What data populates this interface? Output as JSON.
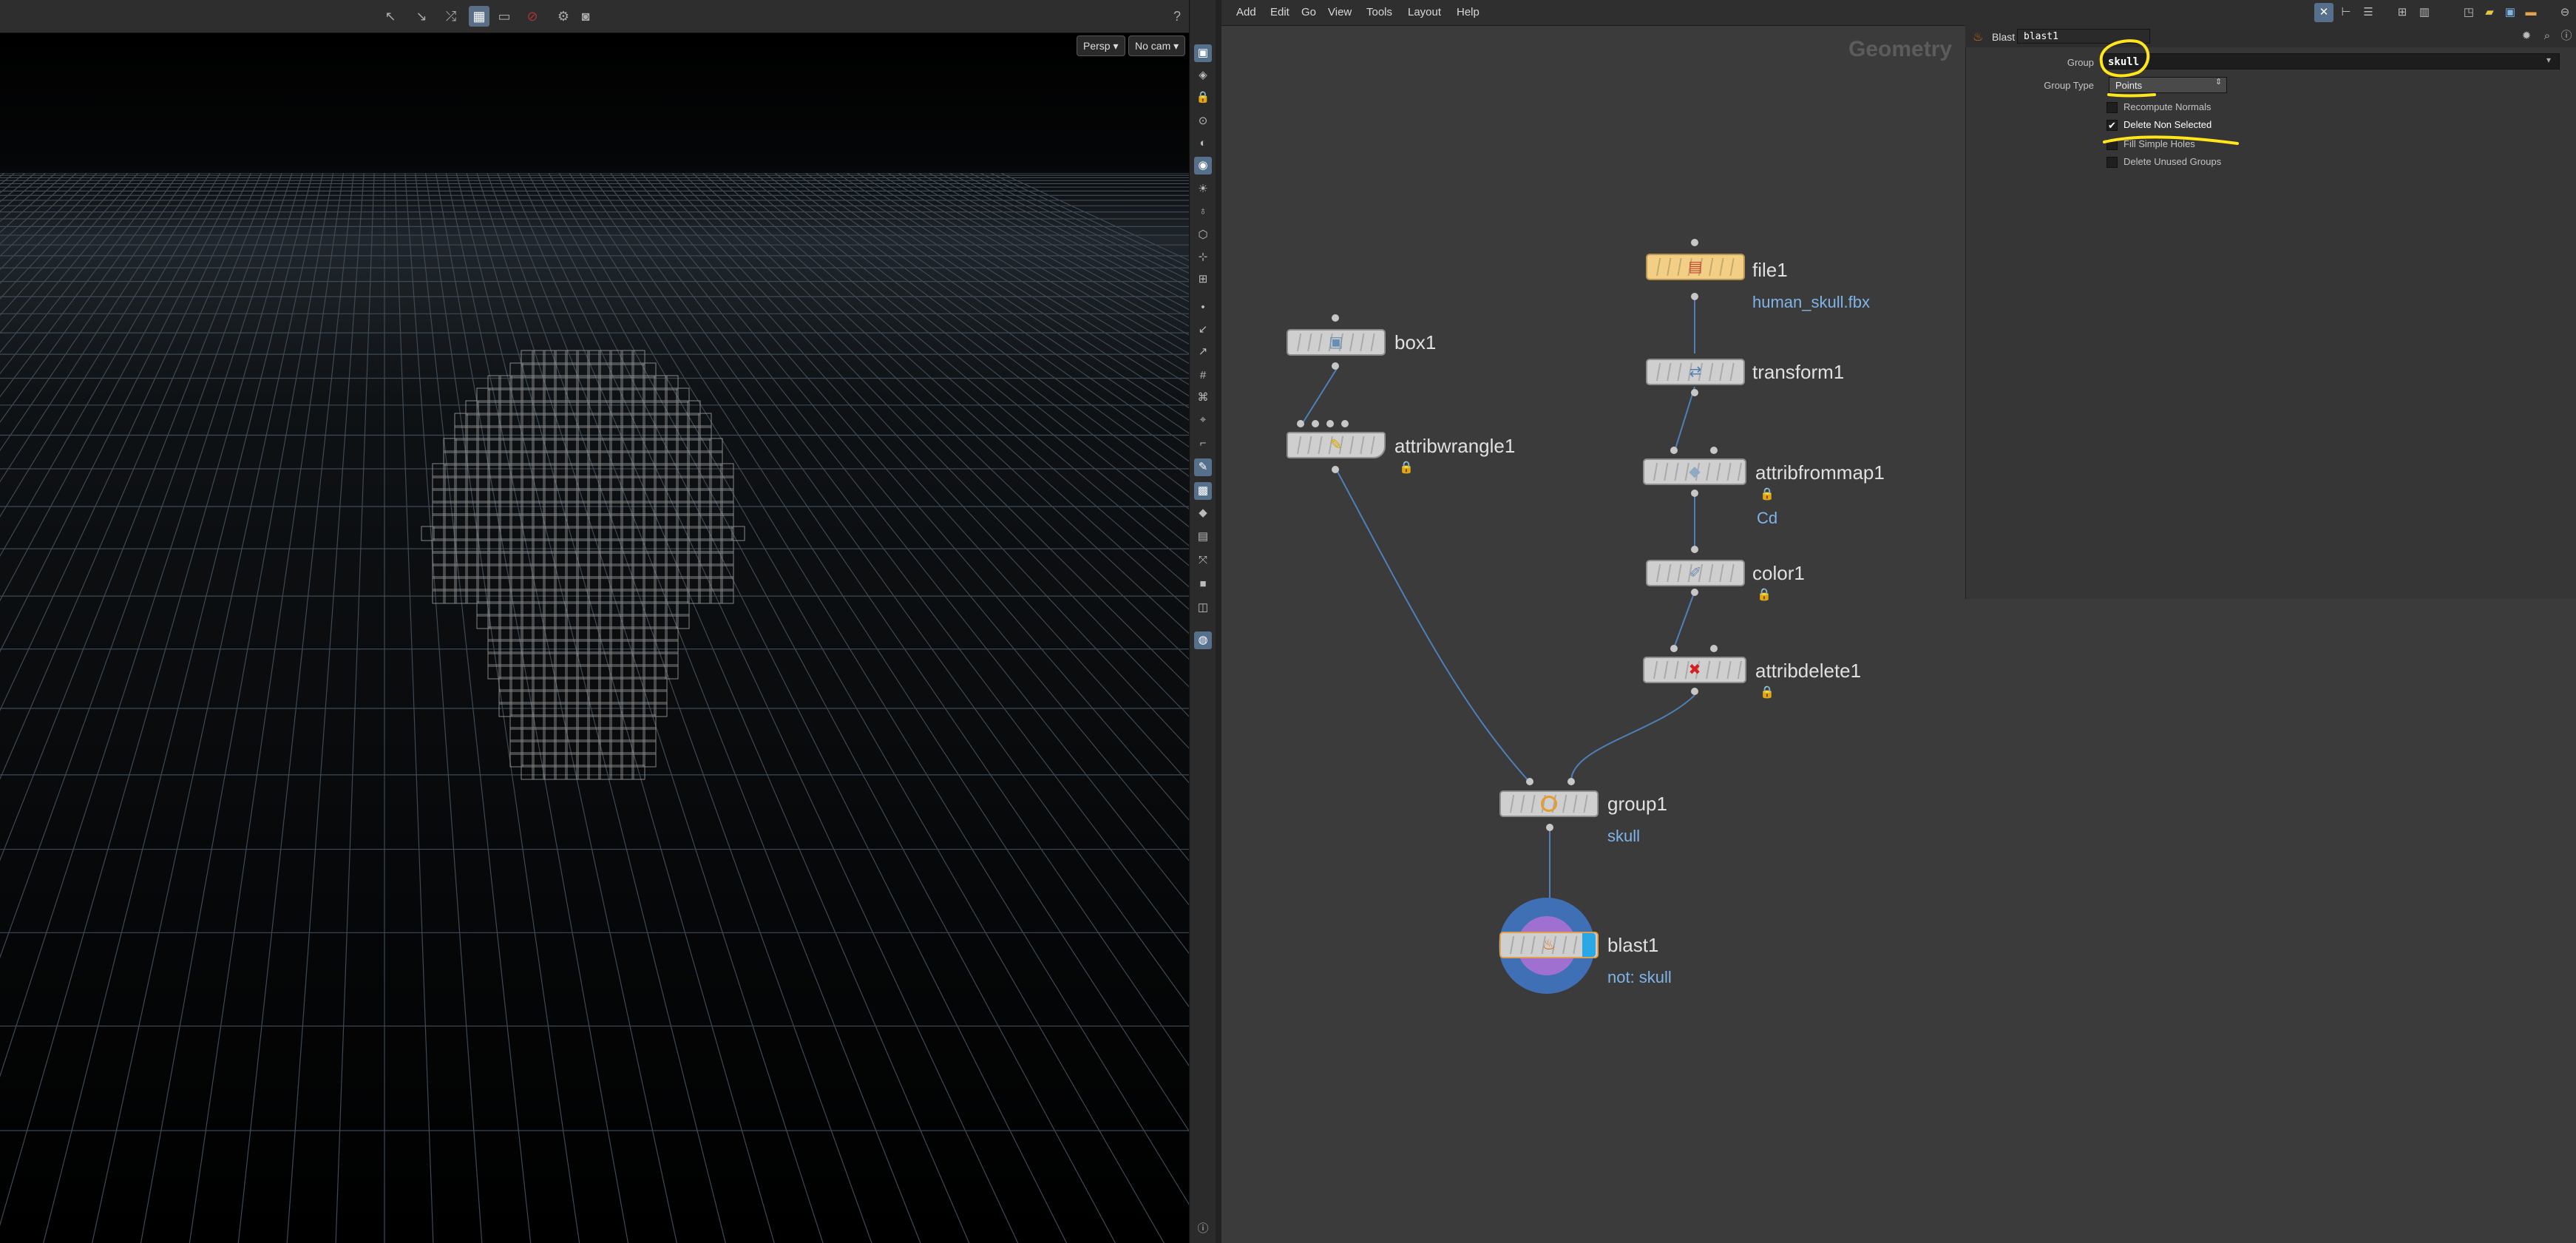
{
  "viewport": {
    "toolbar_icons": [
      "select-arrow-icon",
      "select-arrow-icon",
      "transform-handle-icon",
      "grid-snap-icon",
      "display-icon",
      "record-icon",
      "camera-icon",
      "snapshot-icon",
      "help-icon"
    ],
    "persp_label": "Persp ▾",
    "cam_label": "No cam ▾"
  },
  "menubar": {
    "items": [
      "Add",
      "Edit",
      "Go",
      "View",
      "Tools",
      "Layout",
      "Help"
    ]
  },
  "network": {
    "context_label": "Geometry",
    "nodes": [
      {
        "name": "box1",
        "sub": "",
        "locked": false
      },
      {
        "name": "attribwrangle1",
        "sub": "",
        "locked": true
      },
      {
        "name": "file1",
        "sub": "human_skull.fbx",
        "locked": false
      },
      {
        "name": "transform1",
        "sub": "",
        "locked": false
      },
      {
        "name": "attribfrommap1",
        "sub": "Cd",
        "locked": true
      },
      {
        "name": "color1",
        "sub": "",
        "locked": true
      },
      {
        "name": "attribdelete1",
        "sub": "",
        "locked": true
      },
      {
        "name": "group1",
        "sub": "skull",
        "locked": false
      },
      {
        "name": "blast1",
        "sub": "not: skull",
        "locked": false
      }
    ]
  },
  "params": {
    "node_type": "Blast",
    "node_name": "blast1",
    "group_label": "Group",
    "group_value": "skull",
    "group_type_label": "Group Type",
    "group_type_value": "Points",
    "checkboxes": [
      {
        "label": "Recompute Normals",
        "checked": false
      },
      {
        "label": "Delete Non Selected",
        "checked": true
      },
      {
        "label": "Fill Simple Holes",
        "checked": false
      },
      {
        "label": "Delete Unused Groups",
        "checked": false
      }
    ],
    "annotation_color": "#ffe51a"
  },
  "colors": {
    "viewport_bg": "#000000",
    "network_bg": "#3b3b3b",
    "wire": "#4f7fb8",
    "node_sub": "#7fb4e8",
    "file_node": "#f2cf85",
    "display_flag": "#2aa8e6"
  }
}
